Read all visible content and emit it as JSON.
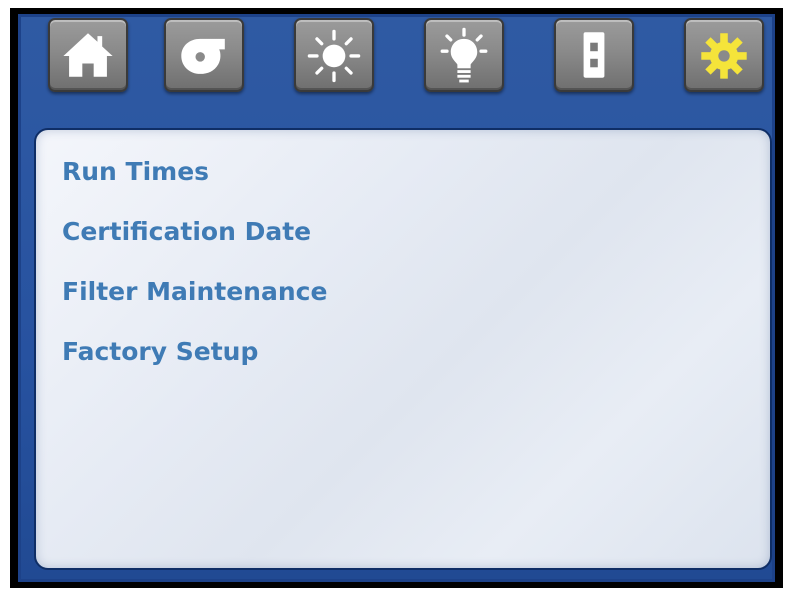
{
  "nav": {
    "buttons": [
      {
        "icon": "home-icon"
      },
      {
        "icon": "blower-fan-icon"
      },
      {
        "icon": "sun-icon"
      },
      {
        "icon": "light-bulb-icon"
      },
      {
        "icon": "outlet-icon"
      },
      {
        "icon": "gear-icon",
        "color": "#f5e43a",
        "selected": true
      }
    ]
  },
  "menu": {
    "items": [
      {
        "label": "Run Times"
      },
      {
        "label": "Certification Date"
      },
      {
        "label": "Filter Maintenance"
      },
      {
        "label": "Factory Setup"
      }
    ]
  },
  "colors": {
    "background_blue": "#2752a0",
    "button_gray": "#8a8a8a",
    "menu_text": "#3f7bb5",
    "active_icon": "#f5e43a"
  }
}
